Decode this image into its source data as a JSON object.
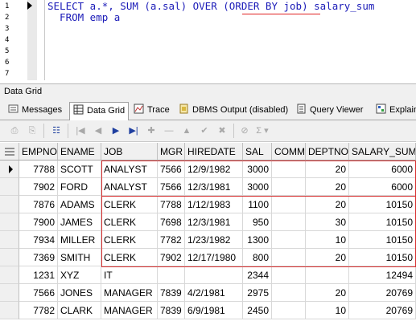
{
  "editor": {
    "line_numbers": [
      "1",
      "2",
      "3",
      "4",
      "5",
      "6",
      "7"
    ],
    "line1": "SELECT a.*, SUM (a.sal) OVER (ORDER BY job) salary_sum",
    "line2": "  FROM emp a"
  },
  "panel": {
    "caption": "Data Grid"
  },
  "tabs": [
    {
      "label": "Messages"
    },
    {
      "label": "Data Grid"
    },
    {
      "label": "Trace"
    },
    {
      "label": "DBMS Output (disabled)"
    },
    {
      "label": "Query Viewer"
    },
    {
      "label": "Explain"
    }
  ],
  "toolbar": {
    "buttons": [
      "print-icon",
      "export-icon",
      "query-icon",
      "first-record-icon",
      "prior-record-icon",
      "next-record-icon",
      "last-record-icon",
      "insert-icon",
      "delete-icon",
      "edit-icon",
      "post-icon",
      "cancel-icon",
      "refresh-icon",
      "sum-icon"
    ]
  },
  "grid": {
    "columns": [
      "EMPNO",
      "ENAME",
      "JOB",
      "MGR",
      "HIREDATE",
      "SAL",
      "COMM",
      "DEPTNO",
      "SALARY_SUM"
    ],
    "rows": [
      [
        "7788",
        "SCOTT",
        "ANALYST",
        "7566",
        "12/9/1982",
        "3000",
        "",
        "20",
        "6000"
      ],
      [
        "7902",
        "FORD",
        "ANALYST",
        "7566",
        "12/3/1981",
        "3000",
        "",
        "20",
        "6000"
      ],
      [
        "7876",
        "ADAMS",
        "CLERK",
        "7788",
        "1/12/1983",
        "1100",
        "",
        "20",
        "10150"
      ],
      [
        "7900",
        "JAMES",
        "CLERK",
        "7698",
        "12/3/1981",
        "950",
        "",
        "30",
        "10150"
      ],
      [
        "7934",
        "MILLER",
        "CLERK",
        "7782",
        "1/23/1982",
        "1300",
        "",
        "10",
        "10150"
      ],
      [
        "7369",
        "SMITH",
        "CLERK",
        "7902",
        "12/17/1980",
        "800",
        "",
        "20",
        "10150"
      ],
      [
        "1231",
        "XYZ",
        "IT",
        "",
        "",
        "2344",
        "",
        "",
        "12494"
      ],
      [
        "7566",
        "JONES",
        "MANAGER",
        "7839",
        "4/2/1981",
        "2975",
        "",
        "20",
        "20769"
      ],
      [
        "7782",
        "CLARK",
        "MANAGER",
        "7839",
        "6/9/1981",
        "2450",
        "",
        "10",
        "20769"
      ]
    ],
    "current_row": 0
  },
  "colors": {
    "highlight_box": "#d83030",
    "sql_text": "#1b1bb8",
    "squiggle": "#e02020"
  }
}
